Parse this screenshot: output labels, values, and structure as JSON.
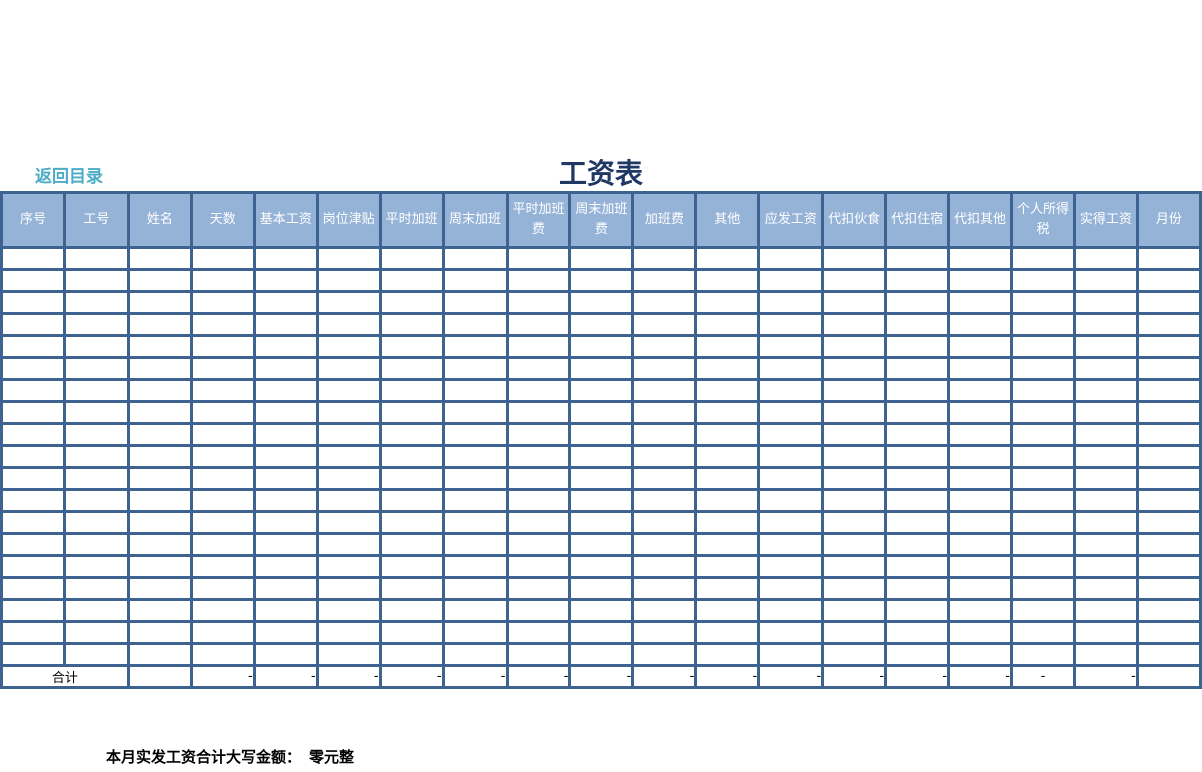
{
  "nav": {
    "back_link": "返回目录"
  },
  "title": "工资表",
  "columns": [
    "序号",
    "工号",
    "姓名",
    "天数",
    "基本工资",
    "岗位津贴",
    "平时加班",
    "周末加班",
    "平时加班费",
    "周末加班费",
    "加班费",
    "其他",
    "应发工资",
    "代扣伙食",
    "代扣住宿",
    "代扣其他",
    "个人所得税",
    "实得工资",
    "月份"
  ],
  "data_row_count": 19,
  "total_row": {
    "label": "合计",
    "values": [
      "",
      "-",
      "-",
      "-",
      "-",
      "-",
      "-",
      "-",
      "-",
      "-",
      "-",
      "-",
      "-",
      "-",
      "-",
      "-",
      ""
    ]
  },
  "footer": {
    "label": "本月实发工资合计大写金额：",
    "value": "零元整"
  },
  "colors": {
    "header_bg": "#95B3D7",
    "border": "#3F6391",
    "title": "#1F3864",
    "link": "#4BACC6"
  }
}
